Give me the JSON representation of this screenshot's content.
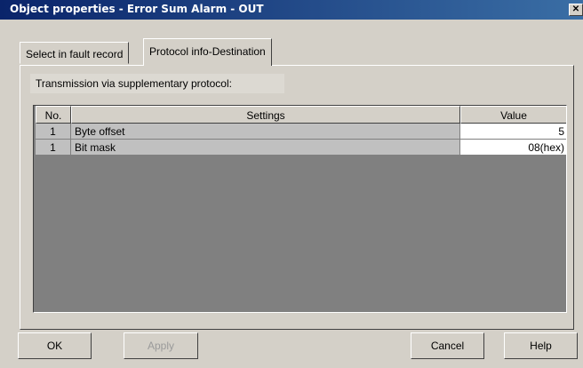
{
  "window": {
    "title": "Object properties - Error Sum Alarm - OUT",
    "close_glyph": "✕"
  },
  "tabs": [
    {
      "label": "Select in fault record",
      "active": false
    },
    {
      "label": "Protocol info-Destination",
      "active": true
    }
  ],
  "group": {
    "label": "Transmission via supplementary protocol:"
  },
  "table": {
    "columns": [
      "No.",
      "Settings",
      "Value"
    ],
    "rows": [
      {
        "no": "1",
        "setting": "Byte offset",
        "value": "5"
      },
      {
        "no": "1",
        "setting": "Bit mask",
        "value": "08(hex)"
      }
    ]
  },
  "buttons": {
    "ok": "OK",
    "apply": "Apply",
    "cancel": "Cancel",
    "help": "Help"
  },
  "colors": {
    "titlebar_start": "#0a246a",
    "titlebar_end": "#3a6ea5",
    "face": "#d4d0c8",
    "grid_background": "#808080"
  }
}
